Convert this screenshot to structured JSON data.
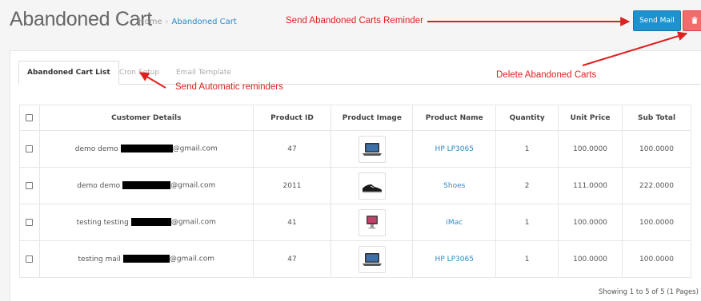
{
  "header": {
    "title": "Abandoned Cart",
    "breadcrumb": [
      {
        "label": "Home"
      },
      {
        "label": "Abandoned Cart"
      }
    ]
  },
  "actions": {
    "send_mail_label": "Send Mail",
    "delete_icon": "trash-icon"
  },
  "annotations": {
    "send_reminder": "Send Abandoned Carts Reminder",
    "delete_carts": "Delete Abandoned Carts",
    "automatic_reminders": "Send Automatic reminders"
  },
  "tabs": [
    {
      "label": "Abandoned Cart List",
      "active": true
    },
    {
      "label": "Cron Setup",
      "active": false
    },
    {
      "label": "Email Template",
      "active": false
    }
  ],
  "table": {
    "columns": [
      "Customer Details",
      "Product ID",
      "Product Image",
      "Product Name",
      "Quantity",
      "Unit Price",
      "Sub Total"
    ],
    "rows": [
      {
        "customer_name": "demo demo",
        "email_suffix": "@gmail.com",
        "product_id": "47",
        "image_icon": "laptop-icon",
        "product_name": "HP LP3065",
        "quantity": "1",
        "unit_price": "100.0000",
        "sub_total": "100.0000"
      },
      {
        "customer_name": "demo demo",
        "email_suffix": "@gmail.com",
        "product_id": "2011",
        "image_icon": "shoe-icon",
        "product_name": "Shoes",
        "quantity": "2",
        "unit_price": "111.0000",
        "sub_total": "222.0000"
      },
      {
        "customer_name": "testing testing",
        "email_suffix": "@gmail.com",
        "product_id": "41",
        "image_icon": "imac-icon",
        "product_name": "iMac",
        "quantity": "1",
        "unit_price": "100.0000",
        "sub_total": "100.0000"
      },
      {
        "customer_name": "testing mail",
        "email_suffix": "@gmail.com",
        "product_id": "47",
        "image_icon": "laptop-icon",
        "product_name": "HP LP3065",
        "quantity": "1",
        "unit_price": "100.0000",
        "sub_total": "100.0000"
      }
    ]
  },
  "pagination": {
    "summary": "Showing 1 to 5 of 5 (1 Pages)"
  },
  "colors": {
    "primary": "#1e91cf",
    "danger": "#f56b6b",
    "annotation": "#e02020",
    "link": "#2c8ac7"
  }
}
